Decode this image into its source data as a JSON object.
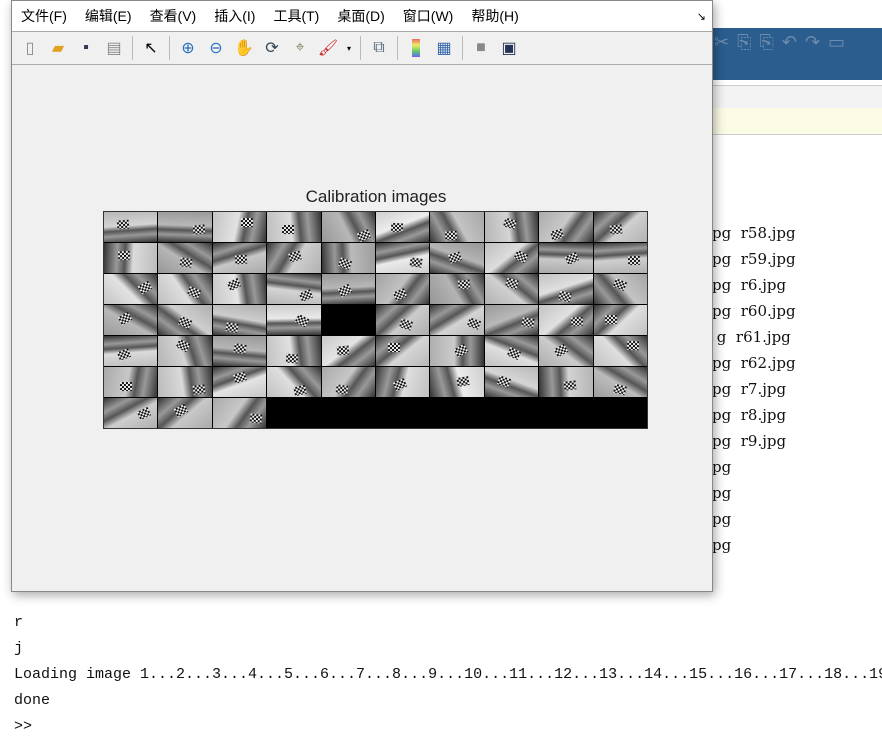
{
  "background": {
    "file_list": [
      "r58.jpg",
      "r59.jpg",
      "r6.jpg",
      "r60.jpg",
      "r61.jpg",
      "r62.jpg",
      "r7.jpg",
      "r8.jpg",
      "r9.jpg"
    ],
    "left_fragments": [
      "pg",
      "pg",
      "pg",
      "pg",
      "g",
      "pg",
      "pg",
      "pg",
      "pg",
      "pg",
      "pg",
      "pg",
      "pg"
    ]
  },
  "command_window": {
    "lines": [
      "r",
      "j",
      "Loading image 1...2...3...4...5...6...7...8...9...10...11...12...13...14...15...16...17...18...19",
      "done"
    ],
    "prompt": ">>"
  },
  "figure": {
    "menu": [
      "文件(F)",
      "编辑(E)",
      "查看(V)",
      "插入(I)",
      "工具(T)",
      "桌面(D)",
      "窗口(W)",
      "帮助(H)"
    ],
    "toolbar": [
      "new-file",
      "open",
      "save",
      "print",
      "pointer",
      "zoom-in",
      "zoom-out",
      "pan",
      "rotate",
      "data-cursor",
      "brush",
      "link",
      "colorbar",
      "legend",
      "hide-plot-tools",
      "show-plot-tools"
    ],
    "axes_title": "Calibration images",
    "mosaic": {
      "columns": 10,
      "rows": 7,
      "image_count": 62,
      "empty_cells": [
        34,
        63,
        64,
        65,
        66,
        67,
        68,
        69
      ]
    }
  }
}
